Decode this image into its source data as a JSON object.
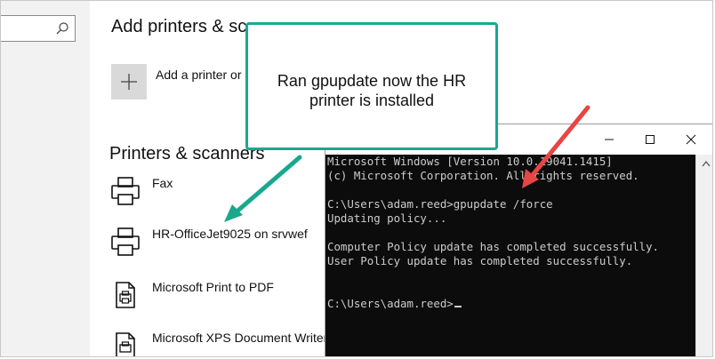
{
  "search": {
    "placeholder": ""
  },
  "main": {
    "add_heading": "Add printers & sc",
    "add_label": "Add a printer or",
    "printers_heading": "Printers & scanners",
    "printers": [
      {
        "name": "Fax"
      },
      {
        "name": "HR-OfficeJet9025 on srvwef"
      },
      {
        "name": "Microsoft Print to PDF"
      },
      {
        "name": "Microsoft XPS Document Writer"
      }
    ]
  },
  "callout": {
    "line1": "Ran gpupdate now the HR",
    "line2": "printer is installed"
  },
  "cmd": {
    "lines": [
      "Microsoft Windows [Version 10.0.19041.1415]",
      "(c) Microsoft Corporation. All rights reserved.",
      "",
      "C:\\Users\\adam.reed>gpupdate /force",
      "Updating policy...",
      "",
      "Computer Policy update has completed successfully.",
      "User Policy update has completed successfully.",
      "",
      "",
      "C:\\Users\\adam.reed>"
    ]
  },
  "colors": {
    "callout_border": "#19a88d",
    "green_arrow": "#19a88d",
    "red_arrow": "#e84545",
    "console_bg": "#0c0c0c",
    "console_text": "#cccccc"
  },
  "icons": [
    "search-icon",
    "plus-icon",
    "printer-icon",
    "pdf-printer-icon",
    "minimize-icon",
    "maximize-icon",
    "close-icon",
    "scroll-up-arrow-icon",
    "arrow-annotation"
  ]
}
